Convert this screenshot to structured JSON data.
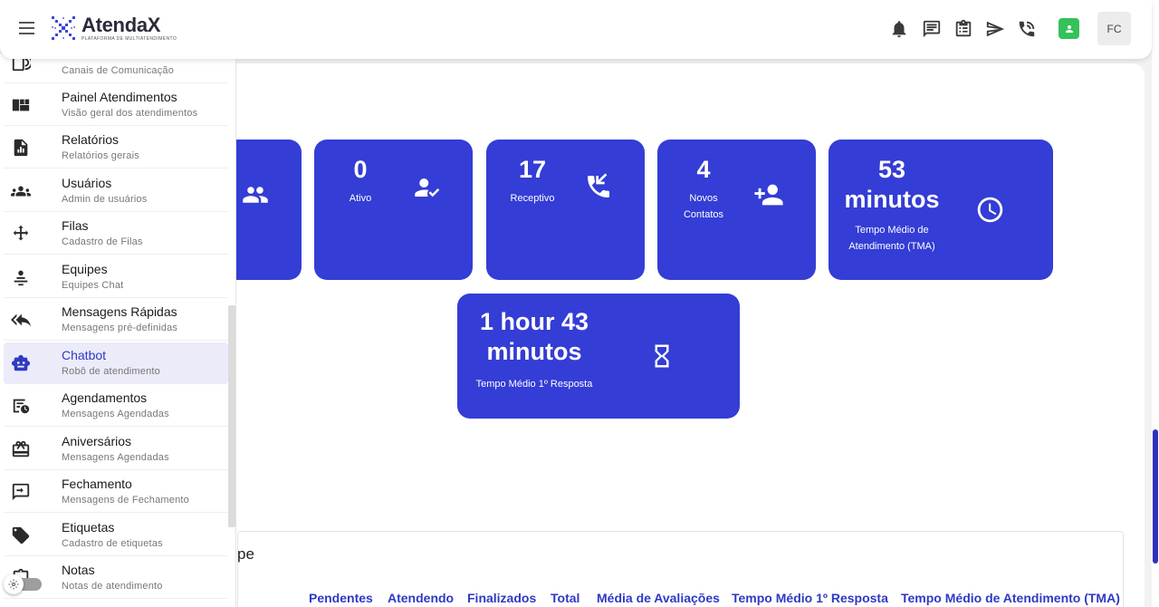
{
  "brand": {
    "name": "AtendaX",
    "tagline": "PLATAFORMA DE MULTIATENDIMENTO"
  },
  "header": {
    "avatar_initials": "FC"
  },
  "sidebar": {
    "items": [
      {
        "title": "",
        "subtitle": "Canais de Comunicação",
        "icon": "phone-wifi-icon"
      },
      {
        "title": "Painel Atendimentos",
        "subtitle": "Visão geral dos atendimentos",
        "icon": "dashboard-icon"
      },
      {
        "title": "Relatórios",
        "subtitle": "Relatórios gerais",
        "icon": "report-icon"
      },
      {
        "title": "Usuários",
        "subtitle": "Admin de usuários",
        "icon": "users-icon"
      },
      {
        "title": "Filas",
        "subtitle": "Cadastro de Filas",
        "icon": "arrows-icon"
      },
      {
        "title": "Equipes",
        "subtitle": "Equipes Chat",
        "icon": "team-icon"
      },
      {
        "title": "Mensagens Rápidas",
        "subtitle": "Mensagens pré-definidas",
        "icon": "reply-all-icon"
      },
      {
        "title": "Chatbot",
        "subtitle": "Robô de atendimento",
        "icon": "robot-icon"
      },
      {
        "title": "Agendamentos",
        "subtitle": "Mensagens Agendadas",
        "icon": "schedule-icon"
      },
      {
        "title": "Aniversários",
        "subtitle": "Mensagens Agendadas",
        "icon": "gift-icon"
      },
      {
        "title": "Fechamento",
        "subtitle": "Mensagens de Fechamento",
        "icon": "close-message-icon"
      },
      {
        "title": "Etiquetas",
        "subtitle": "Cadastro de etiquetas",
        "icon": "tag-icon"
      },
      {
        "title": "Notas",
        "subtitle": "Notas de atendimento",
        "icon": "notes-icon"
      }
    ],
    "active_index": 7
  },
  "cards": {
    "ativo": {
      "value": "0",
      "label": "Ativo"
    },
    "receptivo": {
      "value": "17",
      "label": "Receptivo"
    },
    "novos_contatos": {
      "value": "4",
      "label_line1": "Novos",
      "label_line2": "Contatos"
    },
    "tma": {
      "value_line1": "53",
      "value_line2": "minutos",
      "label_line1": "Tempo Médio de",
      "label_line2": "Atendimento (TMA)"
    },
    "primeira_resposta": {
      "value_line1": "1 hour 43",
      "value_line2": "minutos",
      "label": "Tempo Médio 1º Resposta"
    }
  },
  "table": {
    "section_title_fragment": "pe",
    "columns": [
      "Pendentes",
      "Atendendo",
      "Finalizados",
      "Total",
      "Média de Avaliações",
      "Tempo Médio 1º Resposta",
      "Tempo Médio de Atendimento (TMA)"
    ]
  },
  "colors": {
    "accent": "#343dd5",
    "header_text": "#2f39c3"
  }
}
